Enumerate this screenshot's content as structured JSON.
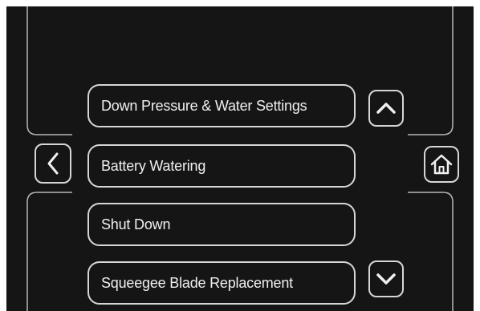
{
  "menu": {
    "items": [
      {
        "label": "Down Pressure & Water Settings"
      },
      {
        "label": "Battery Watering"
      },
      {
        "label": "Shut Down"
      },
      {
        "label": "Squeegee Blade Replacement"
      }
    ]
  },
  "navigation": {
    "back_icon": "chevron-left-icon",
    "home_icon": "home-icon",
    "scroll_up_icon": "chevron-up-icon",
    "scroll_down_icon": "chevron-down-icon"
  },
  "theme": {
    "background": "#151515",
    "outline": "#d6d6d6",
    "text": "#f0f0f0"
  }
}
